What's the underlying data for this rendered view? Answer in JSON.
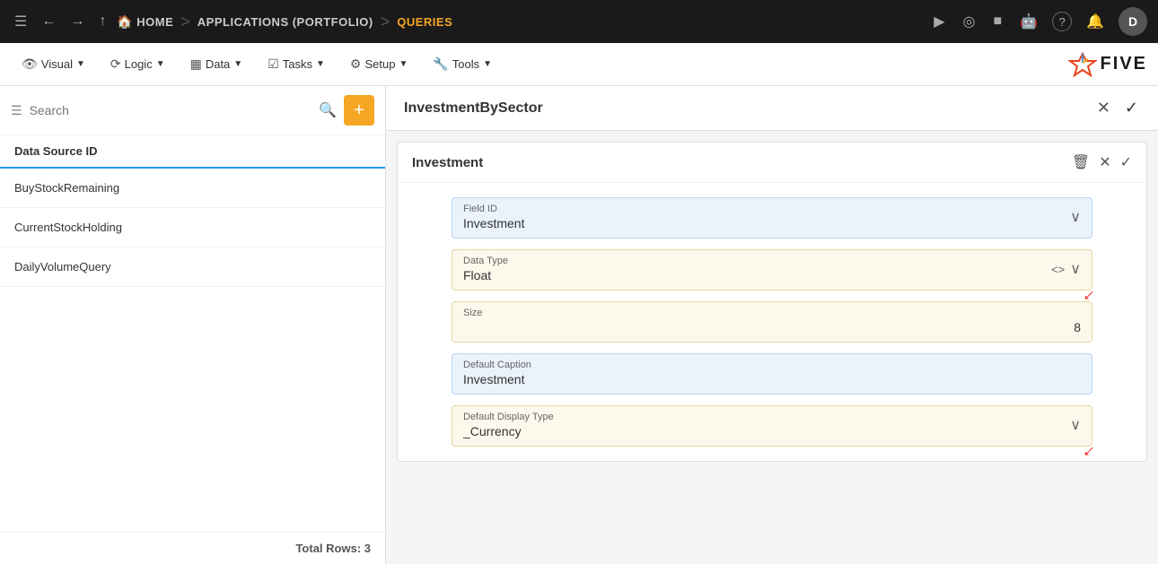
{
  "topNav": {
    "menuIcon": "☰",
    "backIcon": "←",
    "forwardIcon": "→",
    "upIcon": "↑",
    "homeLabel": "HOME",
    "sep1": ">",
    "appLabel": "APPLICATIONS (PORTFOLIO)",
    "sep2": ">",
    "queriesLabel": "QUERIES",
    "playIcon": "▶",
    "searchIcon": "◎",
    "stopIcon": "■",
    "botIcon": "🤖",
    "helpIcon": "?",
    "bellIcon": "🔔",
    "avatarLabel": "D"
  },
  "menuBar": {
    "items": [
      {
        "icon": "👁",
        "label": "Visual",
        "hasArrow": true
      },
      {
        "icon": "⟳",
        "label": "Logic",
        "hasArrow": true
      },
      {
        "icon": "▦",
        "label": "Data",
        "hasArrow": true
      },
      {
        "icon": "☑",
        "label": "Tasks",
        "hasArrow": true
      },
      {
        "icon": "⚙",
        "label": "Setup",
        "hasArrow": true
      },
      {
        "icon": "🔧",
        "label": "Tools",
        "hasArrow": true
      }
    ],
    "logoText": "FIVE"
  },
  "leftPanel": {
    "searchPlaceholder": "Search",
    "addButtonLabel": "+",
    "listHeader": "Data Source ID",
    "listItems": [
      {
        "label": "BuyStockRemaining"
      },
      {
        "label": "CurrentStockHolding"
      },
      {
        "label": "DailyVolumeQuery"
      }
    ],
    "footer": "Total Rows: 3"
  },
  "rightPanel": {
    "title": "InvestmentBySector",
    "closeIcon": "✕",
    "checkIcon": "✓",
    "investmentSection": {
      "title": "Investment",
      "deleteIcon": "🗑",
      "closeIcon": "✕",
      "checkIcon": "✓",
      "fields": {
        "fieldId": {
          "label": "Field ID",
          "value": "Investment"
        },
        "dataType": {
          "label": "Data Type",
          "value": "Float"
        },
        "size": {
          "label": "Size",
          "value": "8"
        },
        "defaultCaption": {
          "label": "Default Caption",
          "value": "Investment"
        },
        "defaultDisplayType": {
          "label": "Default Display Type",
          "value": "_Currency"
        }
      }
    }
  }
}
